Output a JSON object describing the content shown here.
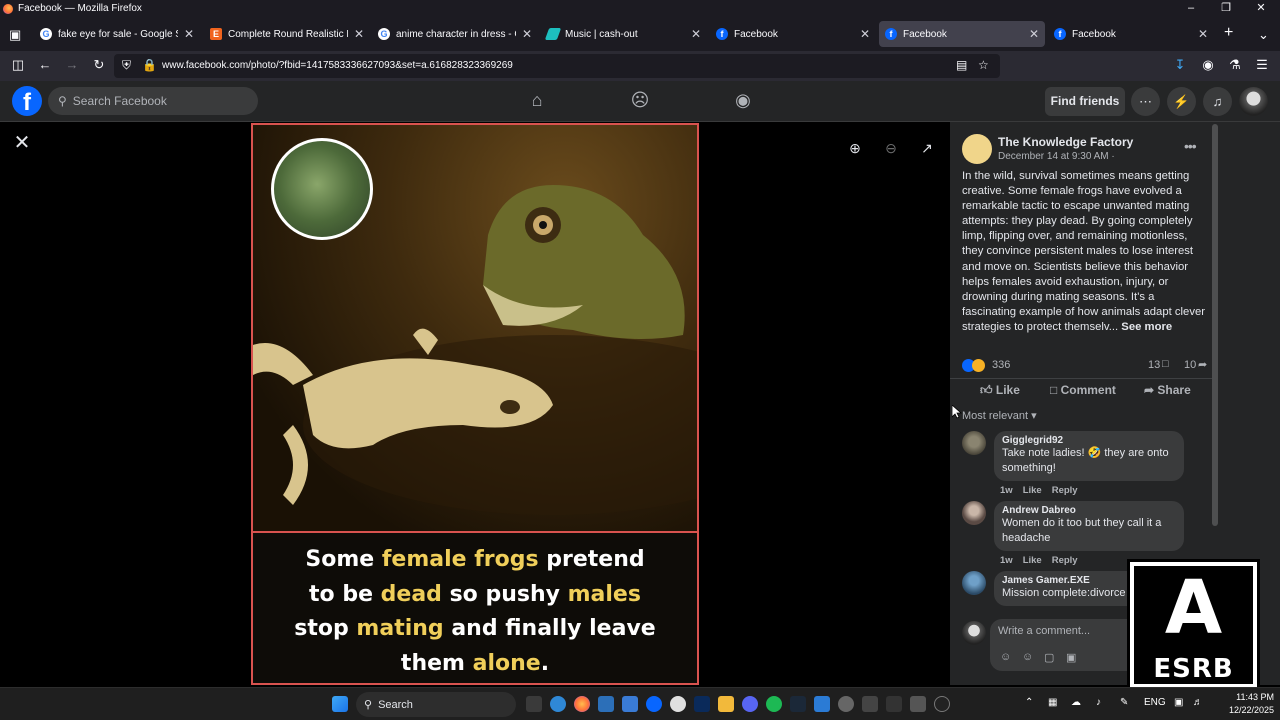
{
  "browser": {
    "window_title": "Facebook — Mozilla Firefox",
    "tabs": [
      {
        "label": "fake eye for sale - Google Search",
        "icon": "google-icon",
        "color": "#ffffff"
      },
      {
        "label": "Complete Round Realistic Human",
        "icon": "etsy-icon",
        "color": "#f1641e"
      },
      {
        "label": "anime character in dress - Google",
        "icon": "google-icon",
        "color": "#ffffff"
      },
      {
        "label": "Music | cash-out",
        "icon": "music-icon",
        "color": "#1dbfbf"
      },
      {
        "label": "Facebook",
        "icon": "facebook-icon",
        "color": "#0866ff"
      },
      {
        "label": "Facebook",
        "icon": "facebook-icon",
        "color": "#0866ff"
      },
      {
        "label": "Facebook",
        "icon": "facebook-icon",
        "color": "#0866ff"
      }
    ],
    "url": "www.facebook.com/photo/?fbid=1417583336627093&set=a.616828323369269"
  },
  "facebook": {
    "search_placeholder": "Search Facebook",
    "find_friends": "Find friends"
  },
  "photo": {
    "caption_lines": [
      [
        {
          "t": "Some ",
          "hl": false
        },
        {
          "t": "female frogs",
          "hl": true
        },
        {
          "t": " pretend",
          "hl": false
        }
      ],
      [
        {
          "t": "to be ",
          "hl": false
        },
        {
          "t": "dead",
          "hl": true
        },
        {
          "t": " so pushy ",
          "hl": false
        },
        {
          "t": "males",
          "hl": true
        }
      ],
      [
        {
          "t": "stop ",
          "hl": false
        },
        {
          "t": "mating",
          "hl": true
        },
        {
          "t": " and finally leave",
          "hl": false
        }
      ],
      [
        {
          "t": "them ",
          "hl": false
        },
        {
          "t": "alone",
          "hl": true
        },
        {
          "t": ".",
          "hl": false
        }
      ]
    ],
    "highlight_color": "#f0cf5a"
  },
  "post": {
    "page_name": "The Knowledge Factory",
    "date": "December 14 at 9:30 AM ·",
    "text": "In the wild, survival sometimes means getting creative. Some female frogs have evolved a remarkable tactic to escape unwanted mating attempts: they play dead. By going completely limp, flipping over, and remaining motionless, they convince persistent males to lose interest and move on. Scientists believe this behavior helps females avoid exhaustion, injury, or drowning during mating seasons. It's a fascinating example of how animals adapt clever strategies to protect themselv...",
    "see_more": "See more",
    "reaction_count": "336",
    "comment_count": "13",
    "share_count": "10",
    "like_label": "Like",
    "comment_label": "Comment",
    "share_label": "Share",
    "sort_label": "Most relevant"
  },
  "comments": [
    {
      "name": "Gigglegrid92",
      "text": "Take note ladies! 🤣 they are onto something!",
      "time": "1w",
      "like": "Like",
      "reply": "Reply"
    },
    {
      "name": "Andrew Dabreo",
      "text": "Women do it too but they call it a headache",
      "time": "1w",
      "like": "Like",
      "reply": "Reply"
    },
    {
      "name": "James Gamer.EXE",
      "text": "Mission complete:divorce"
    }
  ],
  "write_comment_placeholder": "Write a comment...",
  "esrb": {
    "letter": "A",
    "label": "ESRB"
  },
  "taskbar": {
    "search_label": "Search",
    "lang": "ENG",
    "time": "11:43 PM",
    "date": "12/22/2025"
  }
}
